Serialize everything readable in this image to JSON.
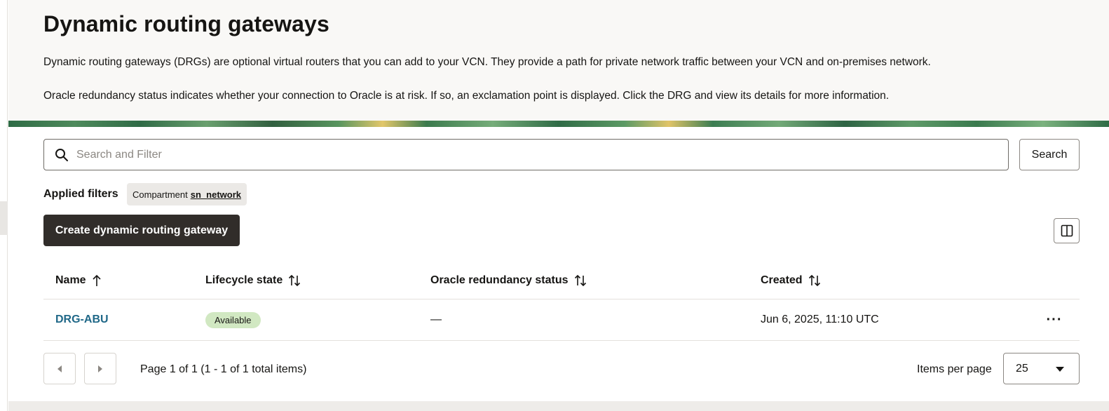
{
  "page": {
    "title": "Dynamic routing gateways",
    "description_1": "Dynamic routing gateways (DRGs) are optional virtual routers that you can add to your VCN. They provide a path for private network traffic between your VCN and on-premises network.",
    "description_2": "Oracle redundancy status indicates whether your connection to Oracle is at risk. If so, an exclamation point is displayed. Click the DRG and view its details for more information."
  },
  "search": {
    "placeholder": "Search and Filter",
    "value": "",
    "button_label": "Search"
  },
  "filters": {
    "label": "Applied filters",
    "chips": [
      {
        "key": "Compartment",
        "value": "sn_network"
      }
    ]
  },
  "toolbar": {
    "create_label": "Create dynamic routing gateway",
    "columns_icon": "columns-icon"
  },
  "table": {
    "columns": [
      {
        "label": "Name",
        "sort": "ascending"
      },
      {
        "label": "Lifecycle state",
        "sort": "sortable"
      },
      {
        "label": "Oracle redundancy status",
        "sort": "sortable"
      },
      {
        "label": "Created",
        "sort": "sortable"
      }
    ],
    "rows": [
      {
        "name": "DRG-ABU",
        "lifecycle_state": "Available",
        "redundancy_status": "—",
        "created": "Jun 6, 2025, 11:10 UTC",
        "actions_label": "···"
      }
    ]
  },
  "pagination": {
    "summary": "Page 1 of 1 (1 - 1 of 1 total items)",
    "items_per_page_label": "Items per page",
    "items_per_page": "25"
  },
  "colors": {
    "primary_button": "#312d2a",
    "link": "#206888",
    "status_available_bg": "#d1e8c2",
    "header_bg": "#f9f8f6"
  }
}
